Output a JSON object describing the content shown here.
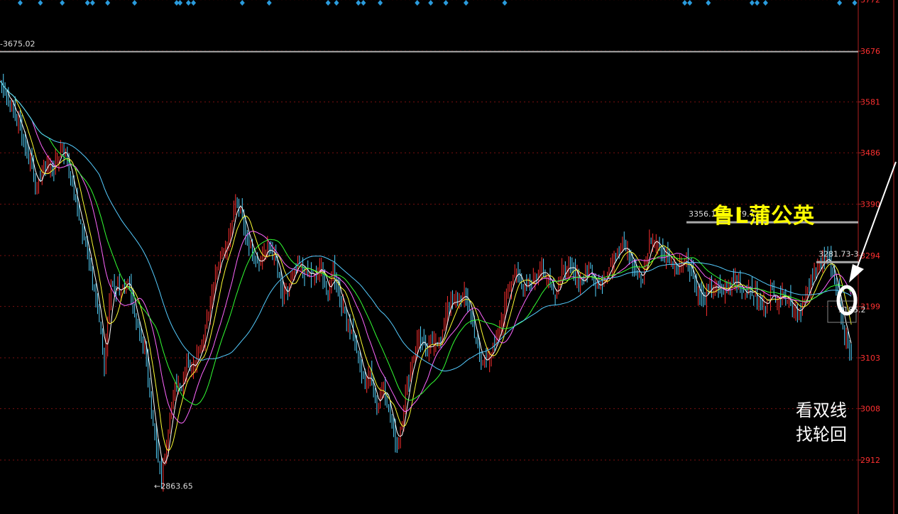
{
  "colors": {
    "background": "#000000",
    "axis": "#b02020",
    "grid": "#7a1010",
    "tick_label": "#ff3030",
    "bar_up": "#ff3030",
    "bar_down": "#54d4ff",
    "ma5": "#ffffff",
    "ma10": "#ffff33",
    "ma20": "#ff66ff",
    "ma30": "#33ff33",
    "ma60": "#55ccff",
    "signal_marker": "#2a9bdc",
    "level_line": "#aaaaaa"
  },
  "texts": {
    "brand": "鲁L蒲公英",
    "note_line1": "看双线",
    "note_line2": "找轮回"
  },
  "chart_data": {
    "type": "candlestick",
    "y_axis": {
      "range": [
        2850,
        3780
      ],
      "ticks": [
        3772,
        3676,
        3581,
        3486,
        3390,
        3294,
        3199,
        3103,
        3008,
        2912
      ]
    },
    "grid": true,
    "annotations": {
      "high_line_label": "3675.02",
      "high_line_value": 3675.02,
      "low_label": "2863.65",
      "low_value": 2863.65,
      "level1_label": "3356.1",
      "level1_label_rest": "79.72",
      "level1_value": 3356.1,
      "level2_label": "3281.73-3",
      "level2_value": 3281.73,
      "small_label": "3185.2",
      "small_label_value": 3185.2
    },
    "price_path": [
      [
        0,
        3620
      ],
      [
        6,
        3580
      ],
      [
        12,
        3535
      ],
      [
        18,
        3470
      ],
      [
        22,
        3420
      ],
      [
        27,
        3470
      ],
      [
        32,
        3455
      ],
      [
        37,
        3500
      ],
      [
        40,
        3470
      ],
      [
        45,
        3390
      ],
      [
        52,
        3300
      ],
      [
        57,
        3220
      ],
      [
        62,
        3090
      ],
      [
        66,
        3240
      ],
      [
        71,
        3230
      ],
      [
        76,
        3240
      ],
      [
        80,
        3185
      ],
      [
        86,
        3120
      ],
      [
        90,
        3000
      ],
      [
        93,
        2935
      ],
      [
        96,
        2880
      ],
      [
        100,
        2965
      ],
      [
        104,
        3060
      ],
      [
        108,
        3040
      ],
      [
        111,
        3100
      ],
      [
        116,
        3090
      ],
      [
        121,
        3140
      ],
      [
        126,
        3230
      ],
      [
        131,
        3300
      ],
      [
        136,
        3325
      ],
      [
        140,
        3400
      ],
      [
        144,
        3360
      ],
      [
        149,
        3310
      ],
      [
        154,
        3280
      ],
      [
        159,
        3310
      ],
      [
        164,
        3285
      ],
      [
        168,
        3210
      ],
      [
        173,
        3250
      ],
      [
        178,
        3280
      ],
      [
        182,
        3260
      ],
      [
        187,
        3255
      ],
      [
        191,
        3275
      ],
      [
        195,
        3215
      ],
      [
        198,
        3270
      ],
      [
        202,
        3215
      ],
      [
        206,
        3180
      ],
      [
        211,
        3130
      ],
      [
        216,
        3060
      ],
      [
        220,
        3070
      ],
      [
        224,
        3010
      ],
      [
        228,
        3060
      ],
      [
        232,
        2990
      ],
      [
        236,
        2940
      ],
      [
        240,
        3010
      ],
      [
        244,
        3090
      ],
      [
        249,
        3140
      ],
      [
        254,
        3110
      ],
      [
        258,
        3140
      ],
      [
        262,
        3125
      ],
      [
        266,
        3210
      ],
      [
        270,
        3200
      ],
      [
        274,
        3220
      ],
      [
        278,
        3210
      ],
      [
        282,
        3150
      ],
      [
        286,
        3090
      ],
      [
        290,
        3110
      ],
      [
        294,
        3120
      ],
      [
        298,
        3170
      ],
      [
        302,
        3230
      ],
      [
        306,
        3270
      ],
      [
        310,
        3235
      ],
      [
        314,
        3245
      ],
      [
        318,
        3250
      ],
      [
        322,
        3270
      ],
      [
        326,
        3255
      ],
      [
        330,
        3220
      ],
      [
        334,
        3260
      ],
      [
        338,
        3275
      ],
      [
        342,
        3255
      ],
      [
        346,
        3245
      ],
      [
        350,
        3270
      ],
      [
        354,
        3235
      ],
      [
        358,
        3250
      ],
      [
        362,
        3270
      ],
      [
        366,
        3295
      ],
      [
        370,
        3320
      ],
      [
        374,
        3300
      ],
      [
        378,
        3260
      ],
      [
        382,
        3250
      ],
      [
        386,
        3320
      ],
      [
        390,
        3320
      ],
      [
        394,
        3300
      ],
      [
        398,
        3290
      ],
      [
        402,
        3270
      ],
      [
        406,
        3290
      ],
      [
        410,
        3275
      ],
      [
        414,
        3230
      ],
      [
        418,
        3210
      ],
      [
        422,
        3235
      ],
      [
        426,
        3235
      ],
      [
        430,
        3225
      ],
      [
        434,
        3240
      ],
      [
        438,
        3250
      ],
      [
        442,
        3225
      ],
      [
        446,
        3230
      ],
      [
        450,
        3215
      ],
      [
        454,
        3200
      ],
      [
        458,
        3225
      ],
      [
        462,
        3215
      ],
      [
        466,
        3225
      ],
      [
        470,
        3205
      ],
      [
        474,
        3190
      ],
      [
        478,
        3210
      ],
      [
        482,
        3240
      ],
      [
        486,
        3275
      ],
      [
        490,
        3285
      ],
      [
        494,
        3275
      ],
      [
        498,
        3220
      ],
      [
        502,
        3150
      ],
      [
        506,
        3110
      ]
    ],
    "signal_markers_top": [
      12,
      24,
      37,
      52,
      55,
      64,
      80,
      105,
      107,
      112,
      115,
      144,
      160,
      195,
      200,
      213,
      216,
      226,
      248,
      256,
      265,
      277,
      300,
      407,
      410,
      421,
      447,
      450,
      455,
      499,
      508
    ]
  }
}
